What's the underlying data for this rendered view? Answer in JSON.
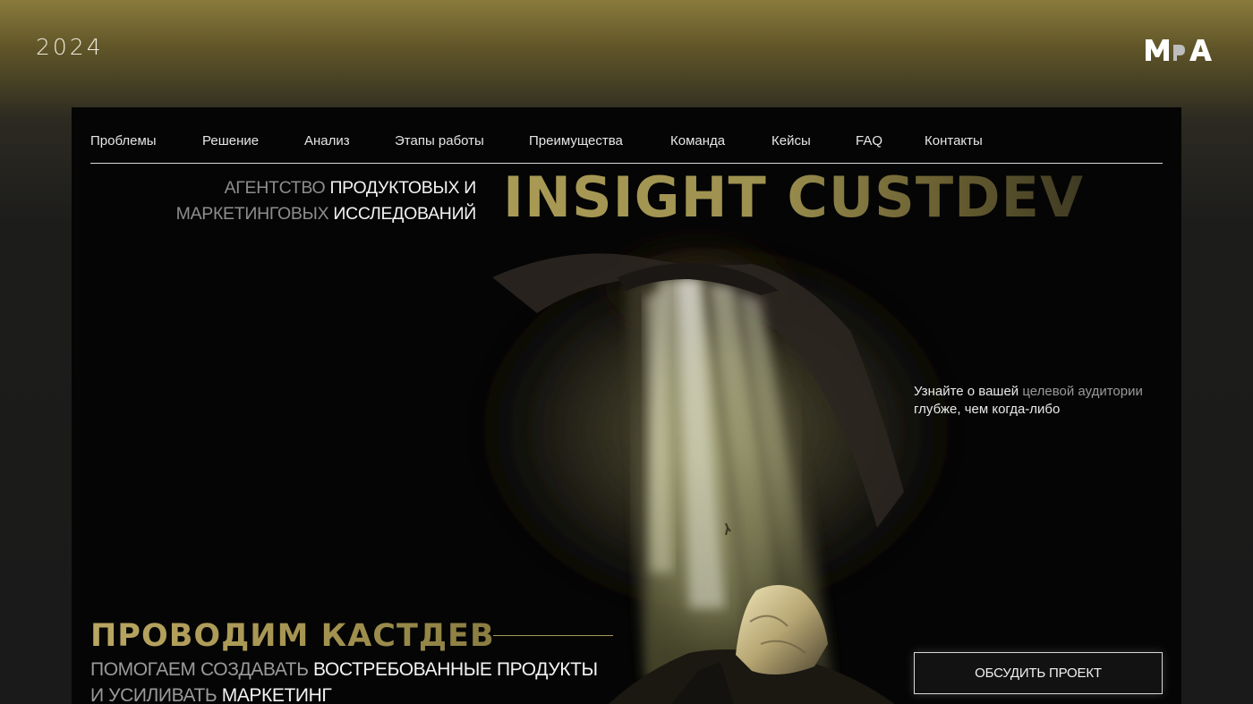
{
  "year": "2024",
  "logo_text": "MPA",
  "nav": [
    "Проблемы",
    "Решение",
    "Анализ",
    "Этапы работы",
    "Преимущества",
    "Команда",
    "Кейсы",
    "FAQ",
    "Контакты"
  ],
  "hero": {
    "subtitle": {
      "line1_gray": "Агентство",
      "line1_white": "продуктовых и",
      "line2_gray": "маркетинговых",
      "line2_white": "исследований"
    },
    "headline": "INSIGHT CUSTDEV",
    "tagline": {
      "line1_white": "Узнайте о вашей",
      "line1_gray": "целевой аудитории",
      "line2_white": "глубже, чем когда-либо"
    },
    "heading": "ПРОВОДИМ КАСТДЕВ",
    "lead": {
      "line1_gray": "Помогаем создавать",
      "line1_white": "востребованные продукты",
      "line2_gray": "и усиливать",
      "line2_white": "маркетинг"
    },
    "cta_label": "Обсудить проект"
  },
  "colors": {
    "accent_gold": "#a99a55",
    "background": "#1a1a1a",
    "frame": "#050505"
  }
}
